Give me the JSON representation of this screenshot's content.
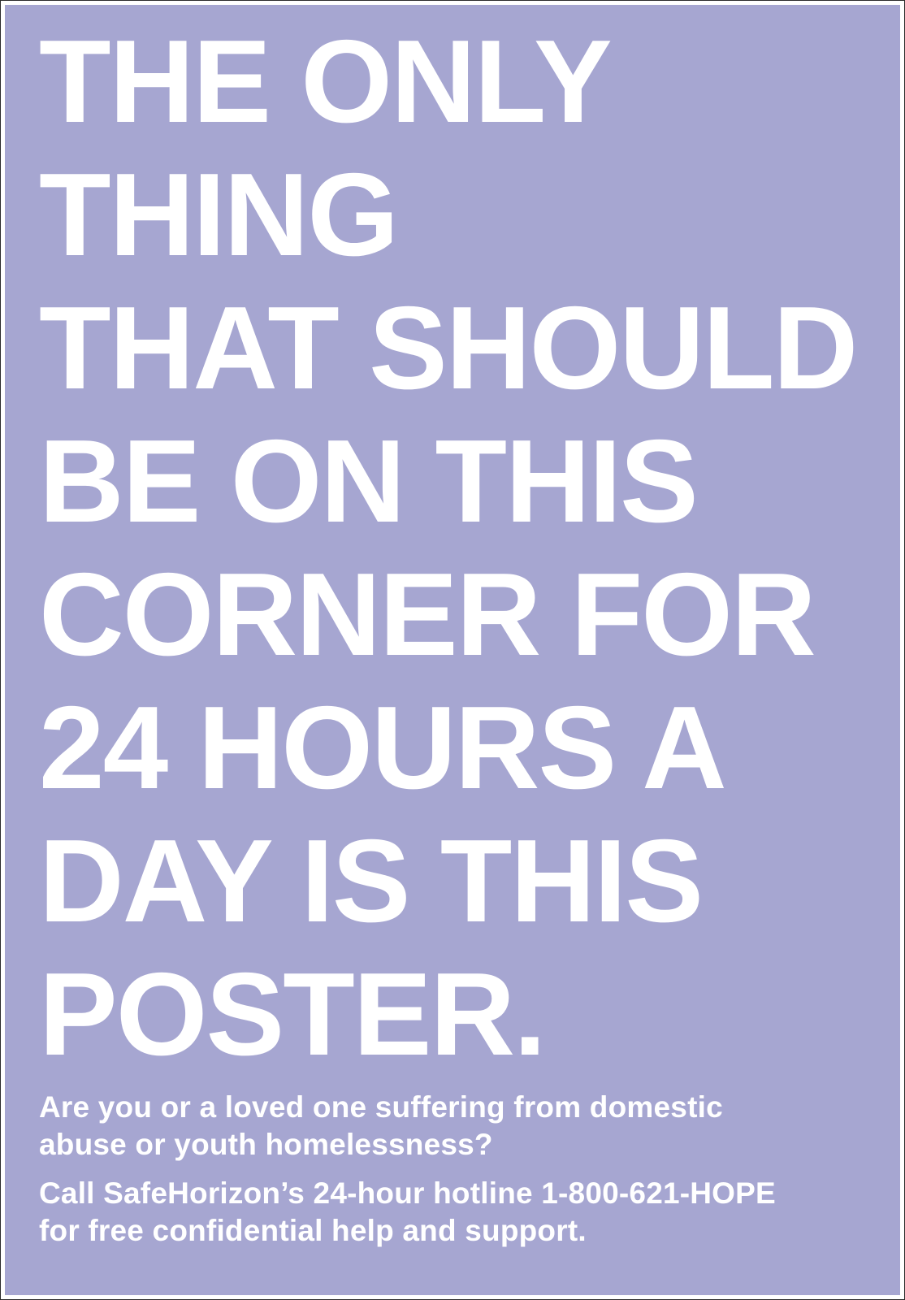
{
  "poster": {
    "background_color": "#a6a6d1",
    "text_color": "#ffffff",
    "headline_lines": [
      "THE ONLY",
      "THING",
      "THAT SHOULD",
      "BE ON THIS",
      "CORNER FOR",
      "24 HOURS A",
      "DAY IS THIS",
      "POSTER."
    ],
    "question": "Are you or a loved one suffering from  domestic\nabuse or youth homelessness?",
    "call_to_action": "Call SafeHorizon’s 24-hour hotline 1-800-621-HOPE\nfor free confidential help and support."
  }
}
